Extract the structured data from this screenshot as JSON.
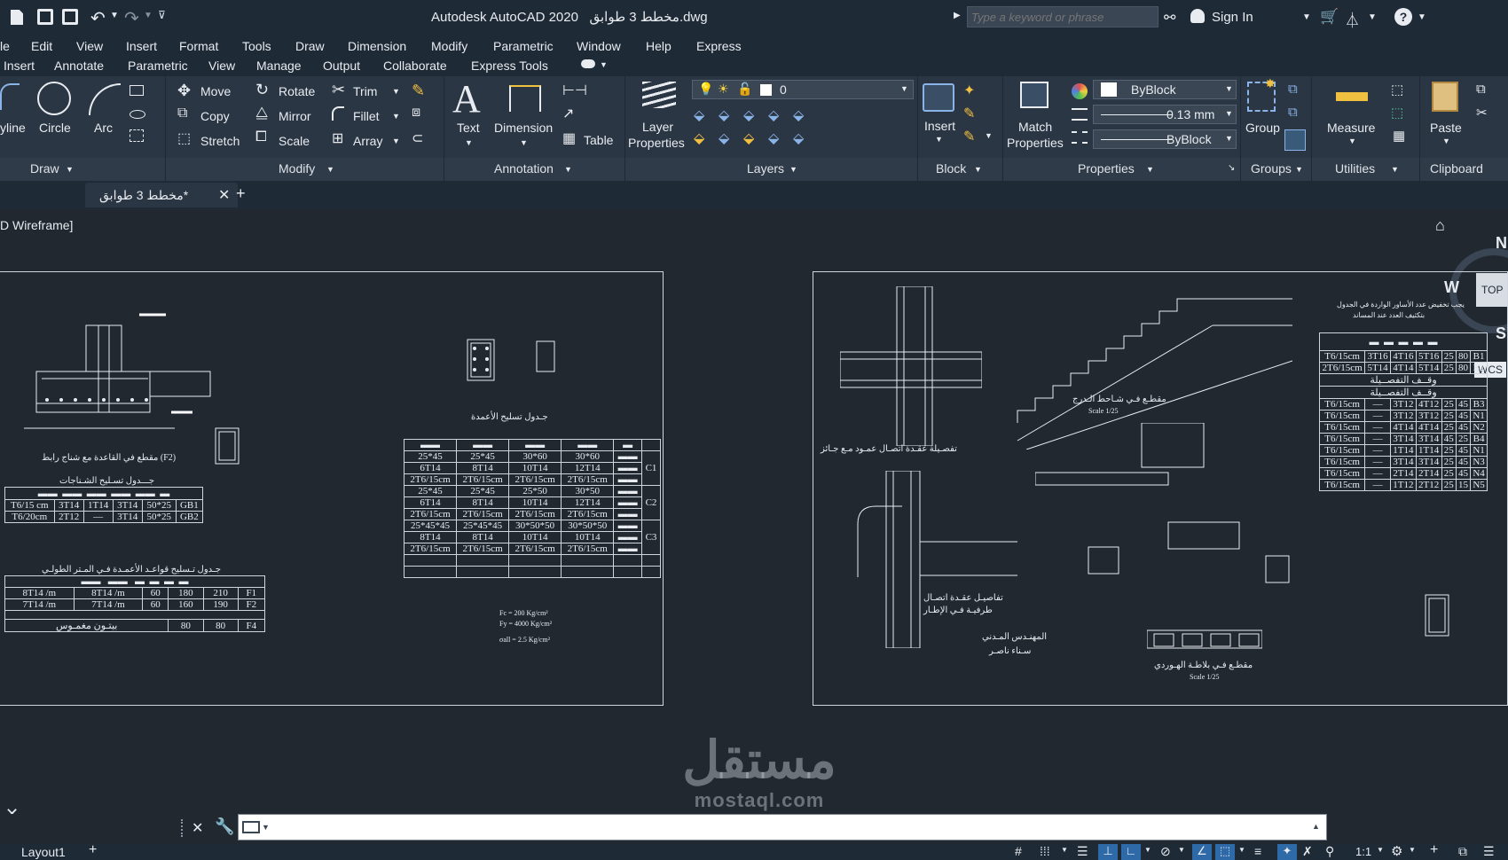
{
  "titlebar": {
    "title": "Autodesk AutoCAD 2020",
    "filename": "مخطط 3 طوابق.dwg",
    "search_placeholder": "Type a keyword or phrase",
    "sign_in": "Sign In"
  },
  "menu": [
    "le",
    "Edit",
    "View",
    "Insert",
    "Format",
    "Tools",
    "Draw",
    "Dimension",
    "Modify",
    "Parametric",
    "Window",
    "Help",
    "Express"
  ],
  "ribbon_tabs": [
    "Insert",
    "Annotate",
    "Parametric",
    "View",
    "Manage",
    "Output",
    "Collaborate",
    "Express Tools"
  ],
  "ribbon": {
    "draw": {
      "polyline": "yline",
      "circle": "Circle",
      "arc": "Arc",
      "title": "Draw"
    },
    "modify": {
      "move": "Move",
      "rotate": "Rotate",
      "trim": "Trim",
      "copy": "Copy",
      "mirror": "Mirror",
      "fillet": "Fillet",
      "stretch": "Stretch",
      "scale": "Scale",
      "array": "Array",
      "title": "Modify"
    },
    "annotation": {
      "text": "Text",
      "dimension": "Dimension",
      "table": "Table",
      "title": "Annotation"
    },
    "layers": {
      "layer_properties_1": "Layer",
      "layer_properties_2": "Properties",
      "current_layer": "0",
      "title": "Layers"
    },
    "block": {
      "insert": "Insert",
      "title": "Block"
    },
    "properties": {
      "match_1": "Match",
      "match_2": "Properties",
      "color": "ByBlock",
      "lineweight": "0.13 mm",
      "linetype": "ByBlock",
      "title": "Properties"
    },
    "groups": {
      "group": "Group",
      "title": "Groups"
    },
    "utilities": {
      "measure": "Measure",
      "title": "Utilities"
    },
    "clipboard": {
      "paste": "Paste",
      "title": "Clipboard"
    }
  },
  "doc_tab": {
    "name": "مخطط 3 طوابق*"
  },
  "viewport": {
    "label": "D Wireframe]"
  },
  "viewcube": {
    "n": "N",
    "w": "W",
    "s": "S",
    "top": "TOP",
    "wcs": "WCS"
  },
  "drawing": {
    "left_sheet": {
      "footing_caption": "مقطع في القاعدة مع شناج رابط (F2)",
      "tie_beam_title": "جـــدول تسـليح الشـناجات",
      "tie_beam_rows": [
        [
          "T6/15 cm",
          "3T14",
          "1T14",
          "3T14",
          "50*25",
          "GB1"
        ],
        [
          "T6/20cm",
          "2T12",
          "—",
          "3T14",
          "50*25",
          "GB2"
        ]
      ],
      "footing_table_title": "جـدول تـسليح قواعـد الأعمـدة فـي المـتر الطولـي",
      "footing_rows": [
        [
          "8T14 /m",
          "8T14 /m",
          "60",
          "180",
          "210",
          "F1"
        ],
        [
          "7T14 /m",
          "7T14 /m",
          "60",
          "160",
          "190",
          "F2"
        ],
        [
          "بيتـون مغمـوس",
          "80",
          "80",
          "F4"
        ]
      ],
      "column_table_title": "جـدول تسليح الأعمدة",
      "column_rows": [
        [
          "25*45",
          "25*45",
          "30*60",
          "30*60"
        ],
        [
          "6T14",
          "8T14",
          "10T14",
          "12T14"
        ],
        [
          "2T6/15cm",
          "2T6/15cm",
          "2T6/15cm",
          "2T6/15cm"
        ],
        [
          "25*45",
          "25*45",
          "25*50",
          "30*50"
        ],
        [
          "6T14",
          "8T14",
          "10T14",
          "12T14"
        ],
        [
          "2T6/15cm",
          "2T6/15cm",
          "2T6/15cm",
          "2T6/15cm"
        ],
        [
          "25*45*45",
          "25*45*45",
          "30*50*50",
          "30*50*50"
        ],
        [
          "8T14",
          "8T14",
          "10T14",
          "10T14"
        ],
        [
          "2T6/15cm",
          "2T6/15cm",
          "2T6/15cm",
          "2T6/15cm"
        ]
      ],
      "column_groups": [
        "C1",
        "C2",
        "C3"
      ],
      "notes": [
        "Fc = 200 Kg/cm²",
        "Fy = 4000 Kg/cm²",
        "σall = 2.5 Kg/cm²"
      ]
    },
    "right_sheet": {
      "joint_caption": "تفصـيلة عقـدة اتصـال عمـود مـع جـائز",
      "stair_caption": "مقطـع فـي شـاحط الـدرج",
      "edge_caption_1": "تفاصيـل عقـدة اتصـال",
      "edge_caption_2": "طرفيـة فـي الإطـار",
      "engineer_1": "المهنـدس المـدني",
      "engineer_2": "سـناء ناصـر",
      "hourdi_caption": "مقطـع فـي بلاطـة الهـوردي",
      "scale": "Scale 1/25",
      "beam_note_1": "يجب تخفيض عدد الأساور الواردة في الجدول",
      "beam_note_2": "بتكثيف العدد عند المساند",
      "beam_rows": [
        [
          "T6/15cm",
          "3T16",
          "4T16",
          "5T16",
          "25",
          "80",
          "B1"
        ],
        [
          "2T6/15cm",
          "5T14",
          "4T14",
          "5T14",
          "25",
          "80",
          "B2"
        ],
        [
          "T6/15cm",
          "3T12",
          "4T12",
          "25",
          "45",
          "B3"
        ],
        [
          "T6/15cm",
          "3T12",
          "3T12",
          "25",
          "45",
          "N1"
        ],
        [
          "T6/15cm",
          "4T14",
          "4T14",
          "25",
          "45",
          "N2"
        ],
        [
          "T6/15cm",
          "3T14",
          "3T14",
          "45",
          "25",
          "B4"
        ],
        [
          "T6/15cm",
          "1T14",
          "1T14",
          "25",
          "45",
          "N1"
        ],
        [
          "T6/15cm",
          "3T14",
          "3T14",
          "25",
          "45",
          "N3"
        ],
        [
          "T6/15cm",
          "2T14",
          "2T14",
          "25",
          "45",
          "N4"
        ],
        [
          "T6/15cm",
          "1T12",
          "2T12",
          "25",
          "15",
          "N5"
        ]
      ],
      "beam_sub_1": "وقــف التفصــيلة",
      "beam_sub_2": "وقــف التفصــيلة"
    }
  },
  "statusbar": {
    "layout": "Layout1",
    "scale": "1:1"
  },
  "watermark": {
    "line1": "مستقل",
    "line2": "mostaql.com"
  }
}
